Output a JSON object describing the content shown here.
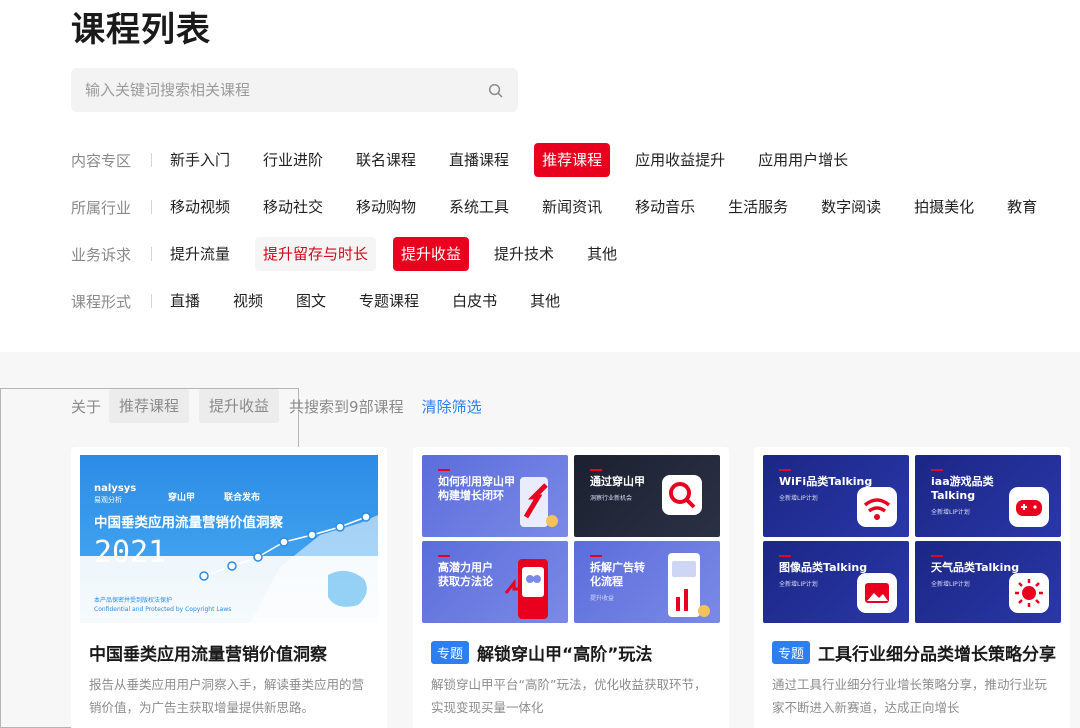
{
  "page": {
    "title": "课程列表"
  },
  "search": {
    "placeholder": "输入关键词搜索相关课程"
  },
  "filters": [
    {
      "label": "内容专区",
      "tags": [
        "新手入门",
        "行业进阶",
        "联名课程",
        "直播课程",
        "推荐课程",
        "应用收益提升",
        "应用用户增长"
      ],
      "active": "推荐课程"
    },
    {
      "label": "所属行业",
      "tags": [
        "移动视频",
        "移动社交",
        "移动购物",
        "系统工具",
        "新闻资讯",
        "移动音乐",
        "生活服务",
        "数字阅读",
        "拍摄美化",
        "教育"
      ]
    },
    {
      "label": "业务诉求",
      "tags": [
        "提升流量",
        "提升留存与时长",
        "提升收益",
        "提升技术",
        "其他"
      ],
      "active": "提升收益",
      "hover": "提升留存与时长"
    },
    {
      "label": "课程形式",
      "tags": [
        "直播",
        "视频",
        "图文",
        "专题课程",
        "白皮书",
        "其他"
      ]
    }
  ],
  "results": {
    "about_label": "关于",
    "chips": [
      "推荐课程",
      "提升收益"
    ],
    "count_text": "共搜索到9部课程",
    "clear_label": "清除筛选"
  },
  "cards": [
    {
      "title": "中国垂类应用流量营销价值洞察",
      "desc": "报告从垂类应用用户洞察入手，解读垂类应用的营销价值，为广告主获取增量提供新思路。",
      "thumb": {
        "logo_left": "nalysys",
        "logo_left_sub": "易观分析",
        "logo_mid": "穿山甲",
        "logo_right": "联合发布",
        "headline": "中国垂类应用流量营销价值洞察",
        "year": "2021",
        "foot1": "本产品保密并受到版权法保护",
        "foot2": "Confidential and Protected by Copyright Laws"
      }
    },
    {
      "badge": "专题",
      "title": "解锁穿山甲“高阶”玩法",
      "desc": "解锁穿山甲平台“高阶”玩法，优化收益获取环节，实现变现买量一体化",
      "tiles": [
        {
          "text": "如何利用穿山甲构建增长闭环",
          "sub": ""
        },
        {
          "text": "通过穿山甲",
          "sub": "洞察行业新机会"
        },
        {
          "text": "高潜力用户获取方法论",
          "sub": ""
        },
        {
          "text": "拆解广告转化流程",
          "sub": "提升收益"
        }
      ]
    },
    {
      "badge": "专题",
      "title": "工具行业细分品类增长策略分享",
      "desc": "通过工具行业细分行业增长策略分享，推动行业玩家不断进入新赛道，达成正向增长",
      "tiles": [
        {
          "text": "WiFi品类Talking",
          "sub": "全新增LIP计划"
        },
        {
          "text": "iaa游戏品类Talking",
          "sub": "全新增LIP计划"
        },
        {
          "text": "图像品类Talking",
          "sub": "全新增LIP计划"
        },
        {
          "text": "天气品类Talking",
          "sub": "全新增LIP计划"
        }
      ]
    }
  ],
  "colors": {
    "accent": "#e8001e",
    "link": "#2d7ff0",
    "badge": "#2d7ff0",
    "tile_dark_blue": "#1d2a8f"
  }
}
